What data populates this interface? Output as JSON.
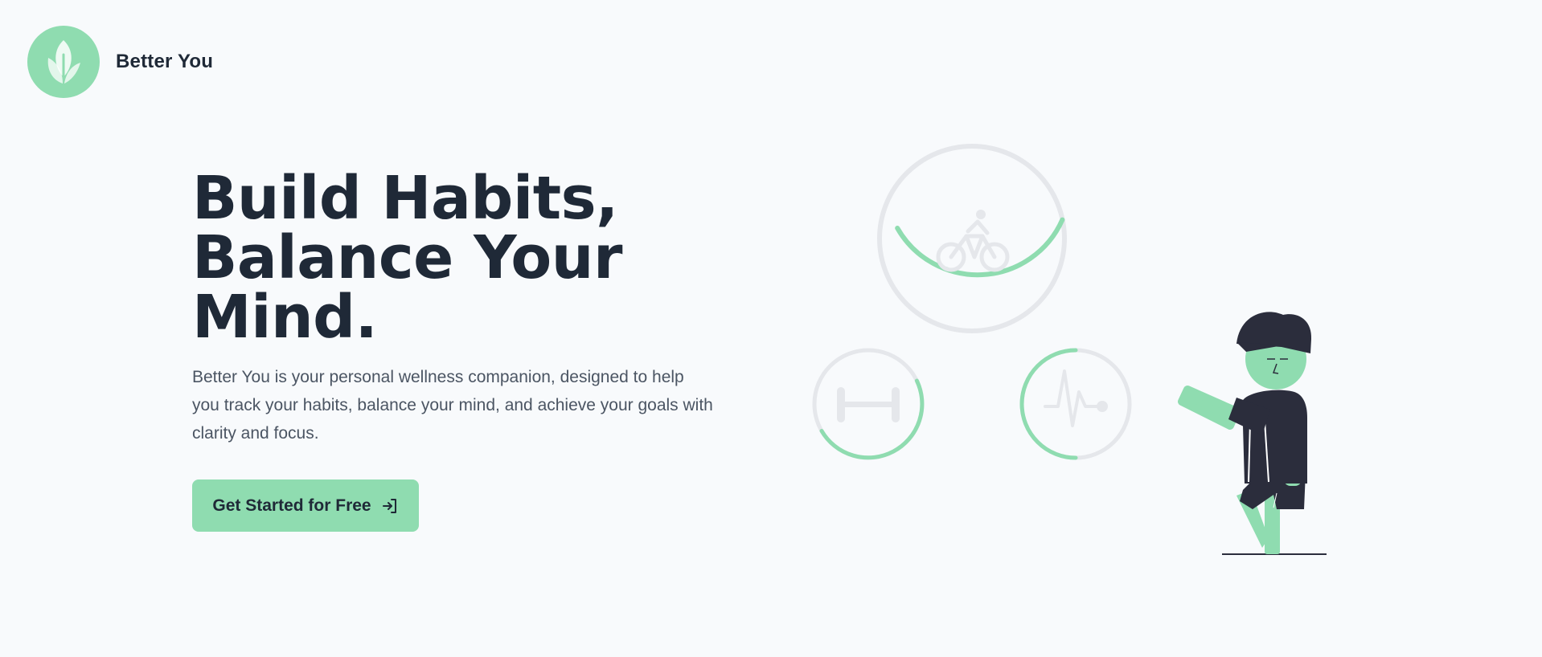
{
  "brand": {
    "name": "Better You",
    "logo_icon": "leaf-icon",
    "accent_color": "#8fdcb0"
  },
  "hero": {
    "title_lines": [
      "Build Habits,",
      "Balance Your",
      "Mind."
    ],
    "description": "Better You is your personal wellness companion, designed to help you track your habits, balance your mind, and achieve your goals with clarity and focus."
  },
  "cta": {
    "label": "Get Started for Free",
    "icon": "sign-in-arrow-icon"
  },
  "illustration": {
    "rings": [
      {
        "icon": "bicycle-icon",
        "progress": 0.33
      },
      {
        "icon": "dumbbell-icon",
        "progress": 0.4
      },
      {
        "icon": "heartbeat-icon",
        "progress": 0.5
      }
    ],
    "figure": "person-waving",
    "colors": {
      "track": "#e5e7eb",
      "progress": "#8fdcb0",
      "figure_dark": "#2b2d3c",
      "figure_skin": "#8fdcb0"
    }
  }
}
